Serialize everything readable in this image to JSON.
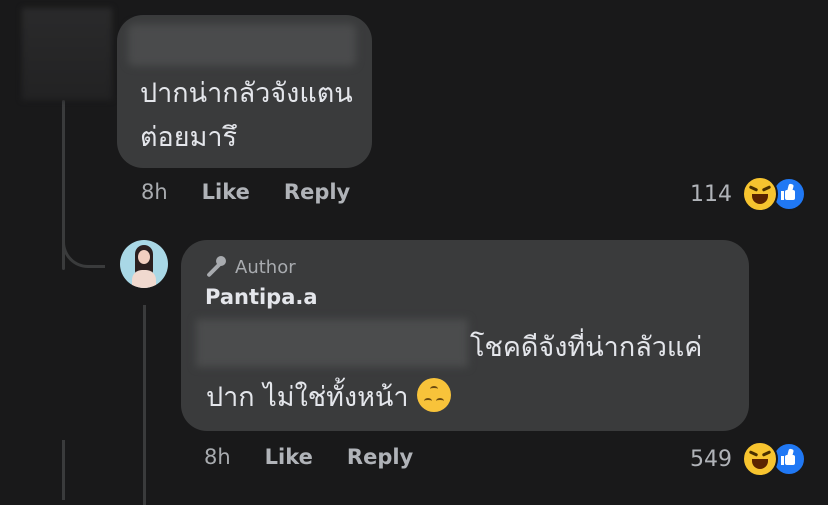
{
  "comment1": {
    "text": "ปากน่ากลัวจังแตนต่อยมารึ",
    "time": "8h",
    "like_label": "Like",
    "reply_label": "Reply",
    "reaction_count": "114",
    "reactions": [
      "haha-icon",
      "like-icon"
    ]
  },
  "comment2": {
    "badge": "Author",
    "author": "Pantipa.a",
    "text_line1": "โชคดีจังที่น่ากลัวแค่",
    "text_line2": "ปาก ไม่ใช่ทั้งหน้า",
    "time": "8h",
    "like_label": "Like",
    "reply_label": "Reply",
    "reaction_count": "549",
    "reactions": [
      "haha-icon",
      "like-icon"
    ]
  },
  "colors": {
    "background": "#19191a",
    "bubble": "#3a3b3c",
    "text": "#e4e6eb",
    "muted": "#b0b3b8",
    "like_blue": "#2078f4",
    "haha_yellow": "#f7c42f"
  }
}
